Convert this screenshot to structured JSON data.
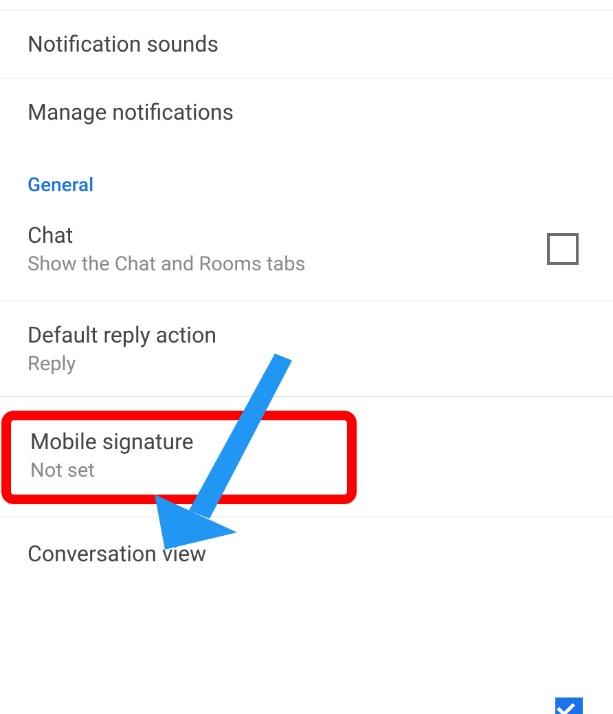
{
  "settings": {
    "notification_sounds": {
      "title": "Notification sounds"
    },
    "manage_notifications": {
      "title": "Manage notifications"
    },
    "section_general": "General",
    "chat": {
      "title": "Chat",
      "subtitle": "Show the Chat and Rooms tabs",
      "checked": false
    },
    "default_reply": {
      "title": "Default reply action",
      "subtitle": "Reply"
    },
    "mobile_signature": {
      "title": "Mobile signature",
      "subtitle": "Not set"
    },
    "conversation_view": {
      "title": "Conversation view"
    }
  },
  "annotation": {
    "arrow_color": "#2196f3",
    "highlight_color": "#ff0000"
  }
}
